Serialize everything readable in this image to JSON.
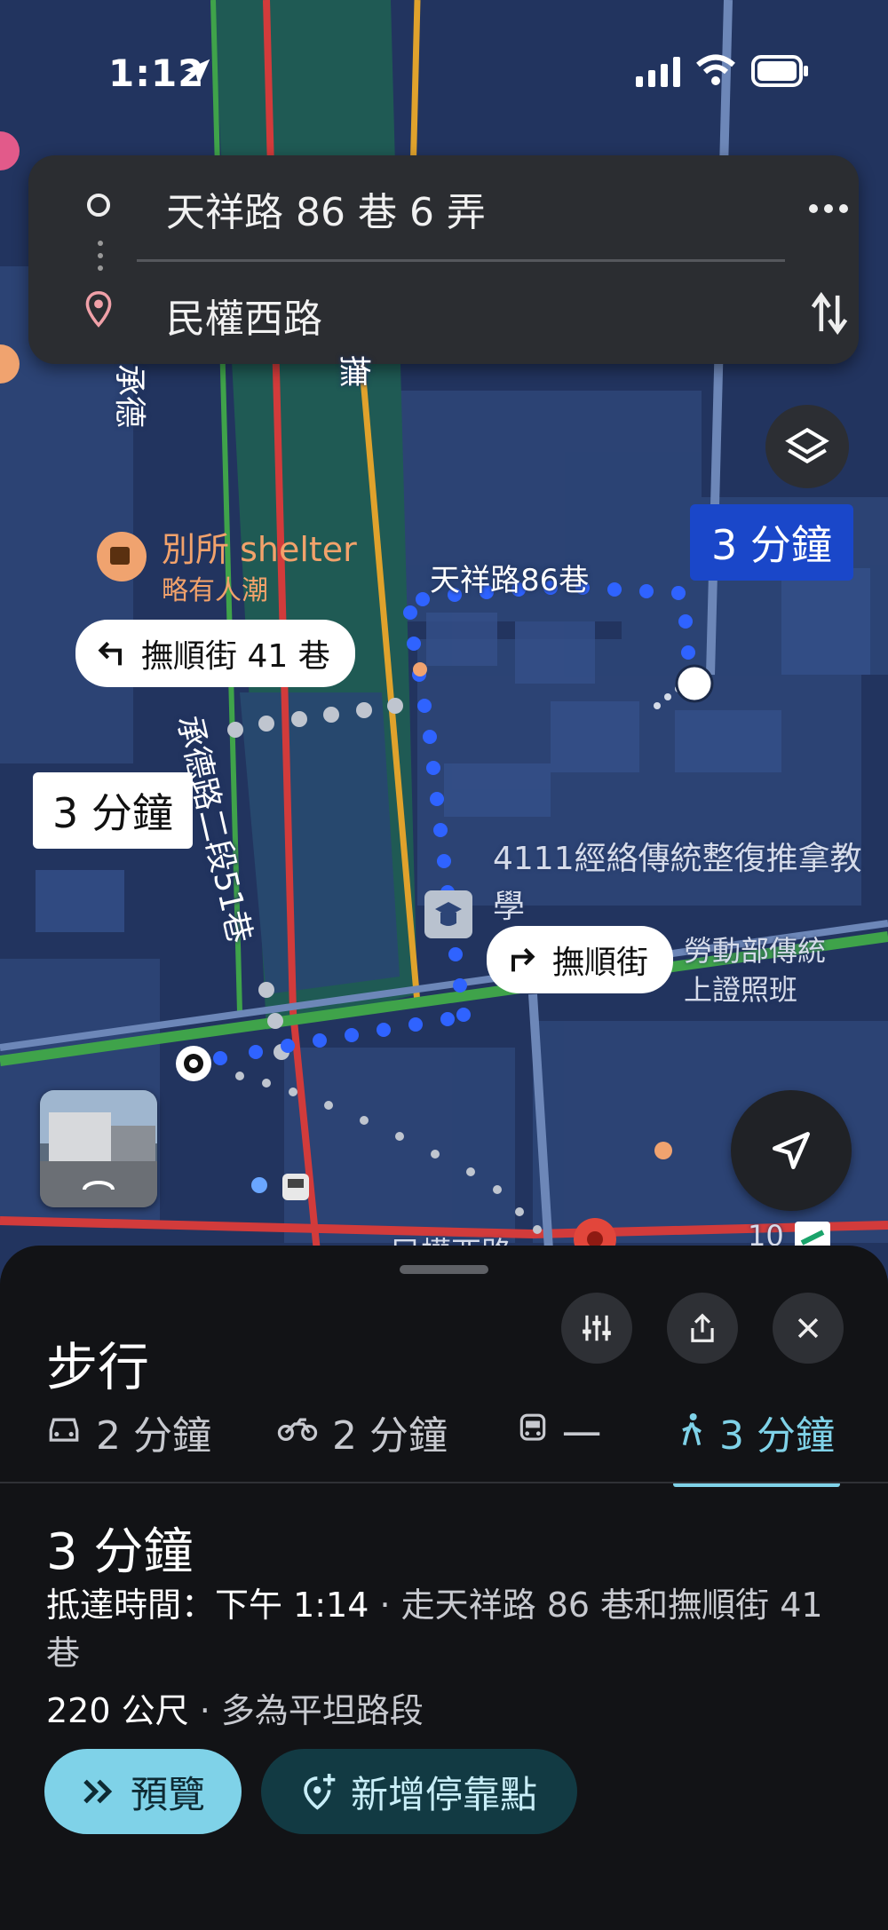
{
  "status_bar": {
    "time": "1:12"
  },
  "route_search": {
    "origin": "天祥路 86 巷 6 弄",
    "destination": "民權西路",
    "more_icon": "more-horizontal-icon",
    "swap_icon": "swap-vertical-icon"
  },
  "map": {
    "route_time_label_primary": "3 分鐘",
    "route_time_label_alt": "3 分鐘",
    "turn_left_label": "撫順街 41 巷",
    "turn_right_label": "撫順街",
    "poi_name": "別所 shelter",
    "poi_sub": "略有人潮",
    "road_label_tianxiang": "天祥路86巷",
    "road_label_chengde": "承德路二段51巷",
    "place_massage_line1": "4111經絡傳統整復推拿教",
    "place_massage_line2": "學",
    "place_labor_line1": "勞動部傳統",
    "place_labor_line2": "上證照班",
    "bottom_road": "民權西路",
    "bottom_number": "10",
    "left_road_1": "承德",
    "left_road_2": "撫"
  },
  "sheet": {
    "title": "步行",
    "modes": [
      {
        "icon": "car-icon",
        "label": "2 分鐘"
      },
      {
        "icon": "motorcycle-icon",
        "label": "2 分鐘"
      },
      {
        "icon": "transit-icon",
        "label": "一"
      },
      {
        "icon": "walk-icon",
        "label": "3 分鐘"
      }
    ],
    "active_mode_index": 3,
    "duration": "3 分鐘",
    "arrival_label": "抵達時間：下午 1:14",
    "via_text": " · 走天祥路 86 巷和撫順街 41巷",
    "distance": "220 公尺",
    "terrain": " · 多為平坦路段",
    "preview_button": "預覽",
    "add_stop_button": "新增停靠點"
  },
  "colors": {
    "accent": "#7fd2e8",
    "route_blue": "#2f63ff",
    "map_bg": "#22345f",
    "sheet_bg": "#121316"
  }
}
